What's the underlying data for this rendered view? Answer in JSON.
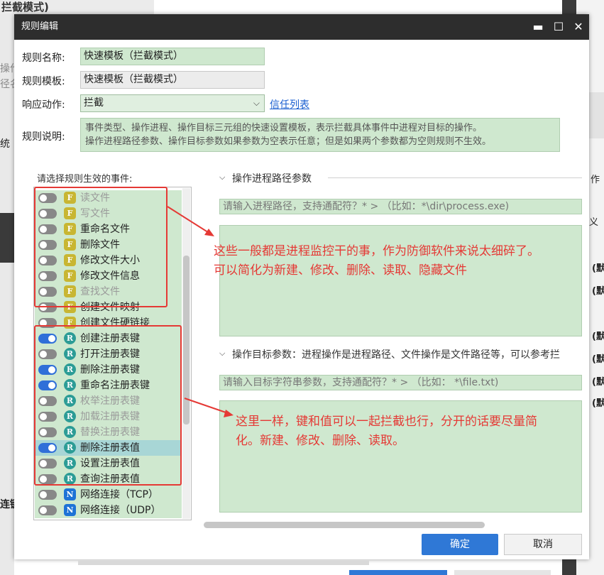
{
  "background": {
    "title_fragment": "拦截模式)",
    "left_fragments": [
      "操作",
      "径名",
      "统",
      "连键"
    ],
    "right_fragments": [
      "作",
      "义",
      "(默",
      "(默",
      "(默",
      "(默",
      "(默",
      "(默"
    ]
  },
  "dialog": {
    "title": "规则编辑",
    "window_buttons": {
      "minimize": "▬",
      "maximize": "☐",
      "close": "✕"
    },
    "form": {
      "rule_name_label": "规则名称:",
      "rule_name_value": "快速模板（拦截模式）",
      "rule_template_label": "规则模板:",
      "rule_template_value": "快速模板（拦截模式）",
      "action_label": "响应动作:",
      "action_value": "拦截",
      "trust_list_link": "信任列表",
      "description_label": "规则说明:",
      "description_line1": "事件类型、操作进程、操作目标三元组的快速设置模板，表示拦截具体事件中进程对目标的操作。",
      "description_line2": "操作进程路径参数、操作目标参数如果参数为空表示任意；但是如果两个参数都为空则规则不生效。"
    },
    "events_label": "请选择规则生效的事件:",
    "events": [
      {
        "type": "F",
        "label": "读文件",
        "on": false,
        "dim": true
      },
      {
        "type": "F",
        "label": "写文件",
        "on": false,
        "dim": true
      },
      {
        "type": "F",
        "label": "重命名文件",
        "on": false,
        "dim": false
      },
      {
        "type": "F",
        "label": "删除文件",
        "on": false,
        "dim": false
      },
      {
        "type": "F",
        "label": "修改文件大小",
        "on": false,
        "dim": false
      },
      {
        "type": "F",
        "label": "修改文件信息",
        "on": false,
        "dim": false
      },
      {
        "type": "F",
        "label": "查找文件",
        "on": false,
        "dim": true
      },
      {
        "type": "F",
        "label": "创建文件映射",
        "on": false,
        "dim": false
      },
      {
        "type": "F",
        "label": "创建文件硬链接",
        "on": false,
        "dim": false
      },
      {
        "type": "R",
        "label": "创建注册表键",
        "on": true,
        "dim": false
      },
      {
        "type": "R",
        "label": "打开注册表键",
        "on": false,
        "dim": false
      },
      {
        "type": "R",
        "label": "删除注册表键",
        "on": true,
        "dim": false
      },
      {
        "type": "R",
        "label": "重命名注册表键",
        "on": true,
        "dim": false
      },
      {
        "type": "R",
        "label": "枚举注册表键",
        "on": false,
        "dim": true
      },
      {
        "type": "R",
        "label": "加载注册表键",
        "on": false,
        "dim": true
      },
      {
        "type": "R",
        "label": "替换注册表键",
        "on": false,
        "dim": true
      },
      {
        "type": "R",
        "label": "删除注册表值",
        "on": true,
        "dim": false,
        "selected": true
      },
      {
        "type": "R",
        "label": "设置注册表值",
        "on": false,
        "dim": false
      },
      {
        "type": "R",
        "label": "查询注册表值",
        "on": false,
        "dim": false
      },
      {
        "type": "N",
        "label": "网络连接（TCP）",
        "on": false,
        "dim": false
      },
      {
        "type": "N",
        "label": "网络连接（UDP）",
        "on": false,
        "dim": false
      }
    ],
    "process_section": {
      "chevron": "⌵",
      "title": "操作进程路径参数",
      "placeholder": "请输入进程路径，支持通配符？* >  （比如：*\\dir\\process.exe)"
    },
    "target_section": {
      "chevron": "⌵",
      "title": "操作目标参数：进程操作是进程路径、文件操作是文件路径等，可以参考拦",
      "placeholder": "请输入目标字符串参数，支持通配符？* >  （比如： *\\file.txt)"
    },
    "buttons": {
      "ok": "确定",
      "cancel": "取消"
    }
  },
  "annotations": {
    "note1_line1": "这些一般都是进程监控干的事，作为防御软件来说太细碎了。",
    "note1_line2": "可以简化为新建、修改、删除、读取、隐藏文件",
    "note2_line1": "这里一样，键和值可以一起拦截也行，分开的话要尽量简",
    "note2_line2": "化。新建、修改、删除、读取。",
    "color": "#e53935"
  }
}
